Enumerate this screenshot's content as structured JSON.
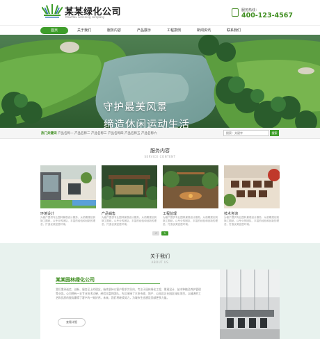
{
  "header": {
    "logo_title": "某某绿化公司",
    "logo_subtitle": "MouMou Greening company",
    "hotline_label": "服务热线：",
    "hotline_number": "400-123-4567"
  },
  "nav": {
    "items": [
      "首页",
      "关于我们",
      "服务内容",
      "产品展示",
      "工程案例",
      "新闻资讯",
      "联系我们"
    ]
  },
  "banner": {
    "line1": "守护最美风景",
    "line2": "缔造休闲运动生活"
  },
  "catbar": {
    "heading": "热门关键词",
    "items": [
      "产品名称一",
      "产品名称二",
      "产品名称三",
      "产品名称四",
      "产品名称五",
      "产品名称六"
    ],
    "search_placeholder": "搜索：关键字",
    "search_button": "搜索"
  },
  "services": {
    "title": "服务内容",
    "subtitle": "SERVICE CONTENT",
    "cards": [
      {
        "title": "环境设计",
        "text": "为客户提供专业园林景观设计服务，从前期规划到施工图纸，以专业的团队、丰富的经验和创新的理念，打造优美宜居环境。"
      },
      {
        "title": "产品销售",
        "text": "为客户提供专业园林景观设计服务，从前期规划到施工图纸，以专业的团队、丰富的经验和创新的理念，打造优美宜居环境。"
      },
      {
        "title": "工程监理",
        "text": "为客户提供专业园林景观设计服务，从前期规划到施工图纸，以专业的团队、丰富的经验和创新的理念，打造优美宜居环境。"
      },
      {
        "title": "技术咨询",
        "text": "为客户提供专业园林景观设计服务，从前期规划到施工图纸，以专业的团队、丰富的经验和创新的理念，打造优美宜居环境。"
      }
    ],
    "pager": [
      "<",
      ">"
    ]
  },
  "about": {
    "title": "关于我们",
    "subtitle": "ABOUT US",
    "company": "某某园林绿化公司",
    "text": "我们秉承诚信、创新、服务至上的理念，始终坚持以客户需求为导向，专注于园林绿化工程、景观设计、苗木种植及养护管理等业务。公司拥有一支专业技术过硬、经验丰富的团队，先后承接了众多市政、地产、公园及企业园区绿化项目，以精湛的工艺和优质的服务赢得了客户的一致好评。未来，我们将继续努力，为城市生态建设贡献更多力量。",
    "button": "查看详细"
  },
  "colors": {
    "brand_green": "#3e9d2a",
    "about_bg": "#e8f2ee"
  }
}
